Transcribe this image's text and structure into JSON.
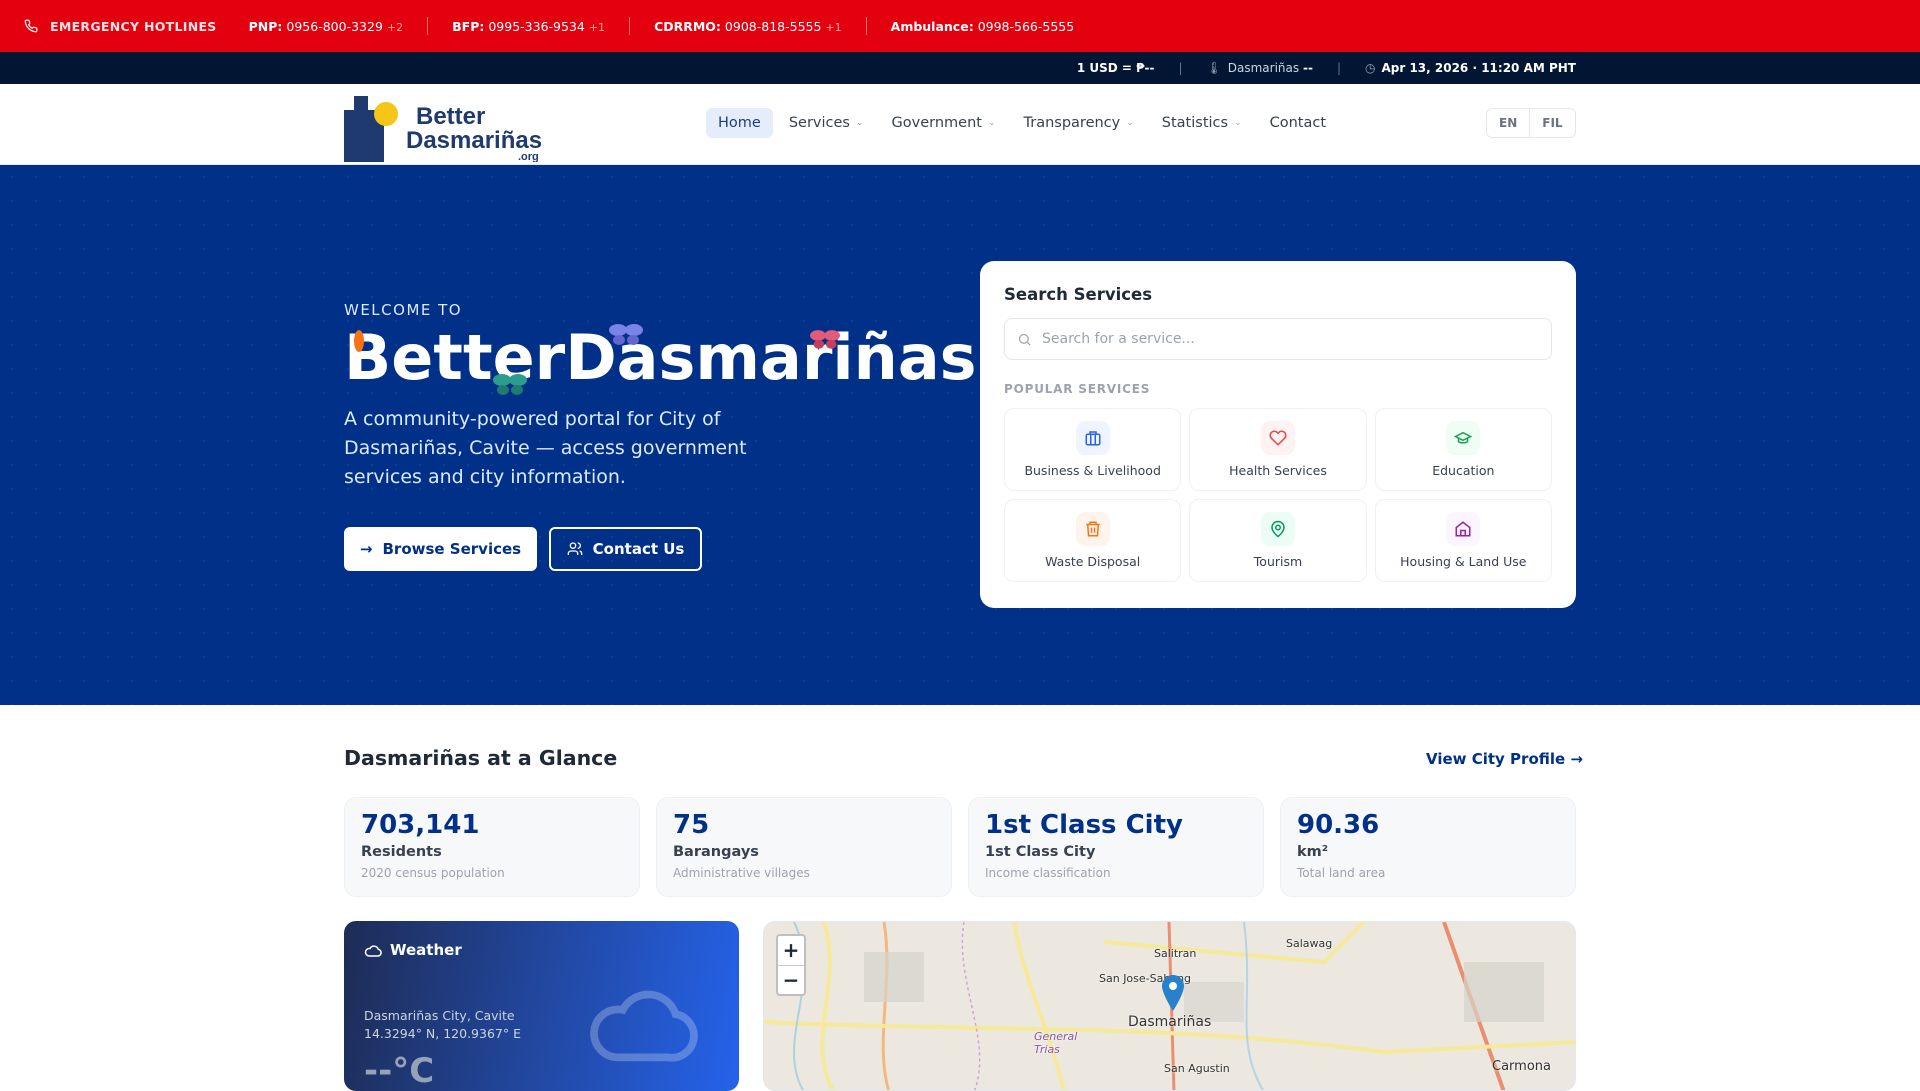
{
  "emergency": {
    "label": "EMERGENCY HOTLINES",
    "hotlines": [
      {
        "agency": "PNP:",
        "number": "0956-800-3329",
        "extra": "+2"
      },
      {
        "agency": "BFP:",
        "number": "0995-336-9534",
        "extra": "+1"
      },
      {
        "agency": "CDRRMO:",
        "number": "0908-818-5555",
        "extra": "+1"
      },
      {
        "agency": "Ambulance:",
        "number": "0998-566-5555",
        "extra": ""
      }
    ]
  },
  "infobar": {
    "currency": "1 USD = ₱--",
    "weather_place": "Dasmariñas",
    "weather_value": "--",
    "datetime": "Apr 13, 2026 · 11:20 AM PHT"
  },
  "logo": {
    "text": "BetterDasmariñas.org"
  },
  "nav": {
    "items": [
      {
        "label": "Home",
        "dropdown": false
      },
      {
        "label": "Services",
        "dropdown": true
      },
      {
        "label": "Government",
        "dropdown": true
      },
      {
        "label": "Transparency",
        "dropdown": true
      },
      {
        "label": "Statistics",
        "dropdown": true
      },
      {
        "label": "Contact",
        "dropdown": false
      }
    ],
    "languages": [
      "EN",
      "FIL"
    ]
  },
  "hero": {
    "welcome": "WELCOME TO",
    "title": "BetterDasmariñas.org",
    "description": "A community-powered portal for City of Dasmariñas, Cavite — access government services and city information.",
    "browse_label": "Browse Services",
    "contact_label": "Contact Us"
  },
  "search": {
    "title": "Search Services",
    "placeholder": "Search for a service...",
    "popular_label": "POPULAR SERVICES",
    "services": [
      {
        "label": "Business & Livelihood",
        "icon": "briefcase-icon",
        "color": "#2563eb",
        "bg": "#eff4ff"
      },
      {
        "label": "Health Services",
        "icon": "heart-icon",
        "color": "#ef4444",
        "bg": "#fef2f2"
      },
      {
        "label": "Education",
        "icon": "graduation-cap-icon",
        "color": "#16a34a",
        "bg": "#f0fdf4"
      },
      {
        "label": "Waste Disposal",
        "icon": "trash-icon",
        "color": "#f97316",
        "bg": "#fff4ec"
      },
      {
        "label": "Tourism",
        "icon": "map-pin-icon",
        "color": "#059669",
        "bg": "#ecfdf5"
      },
      {
        "label": "Housing & Land Use",
        "icon": "home-icon",
        "color": "#a21caf",
        "bg": "#faf5ff"
      }
    ]
  },
  "glance": {
    "title": "Dasmariñas at a Glance",
    "profile_link": "View City Profile →",
    "stats": [
      {
        "value": "703,141",
        "label": "Residents",
        "sub": "2020 census population"
      },
      {
        "value": "75",
        "label": "Barangays",
        "sub": "Administrative villages"
      },
      {
        "value": "1st Class City",
        "label": "1st Class City",
        "sub": "Income classification"
      },
      {
        "value": "90.36",
        "label": "km²",
        "sub": "Total land area"
      }
    ]
  },
  "weather": {
    "title": "Weather",
    "location": "Dasmariñas City, Cavite",
    "coords": "14.3294° N, 120.9367° E",
    "temp": "--°C"
  },
  "map": {
    "zoom_in": "+",
    "zoom_out": "−",
    "labels": [
      "Salitran",
      "Salawag",
      "San Jose-Sabang",
      "Dasmariñas",
      "General Trias",
      "San Agustin",
      "Carmona"
    ]
  }
}
